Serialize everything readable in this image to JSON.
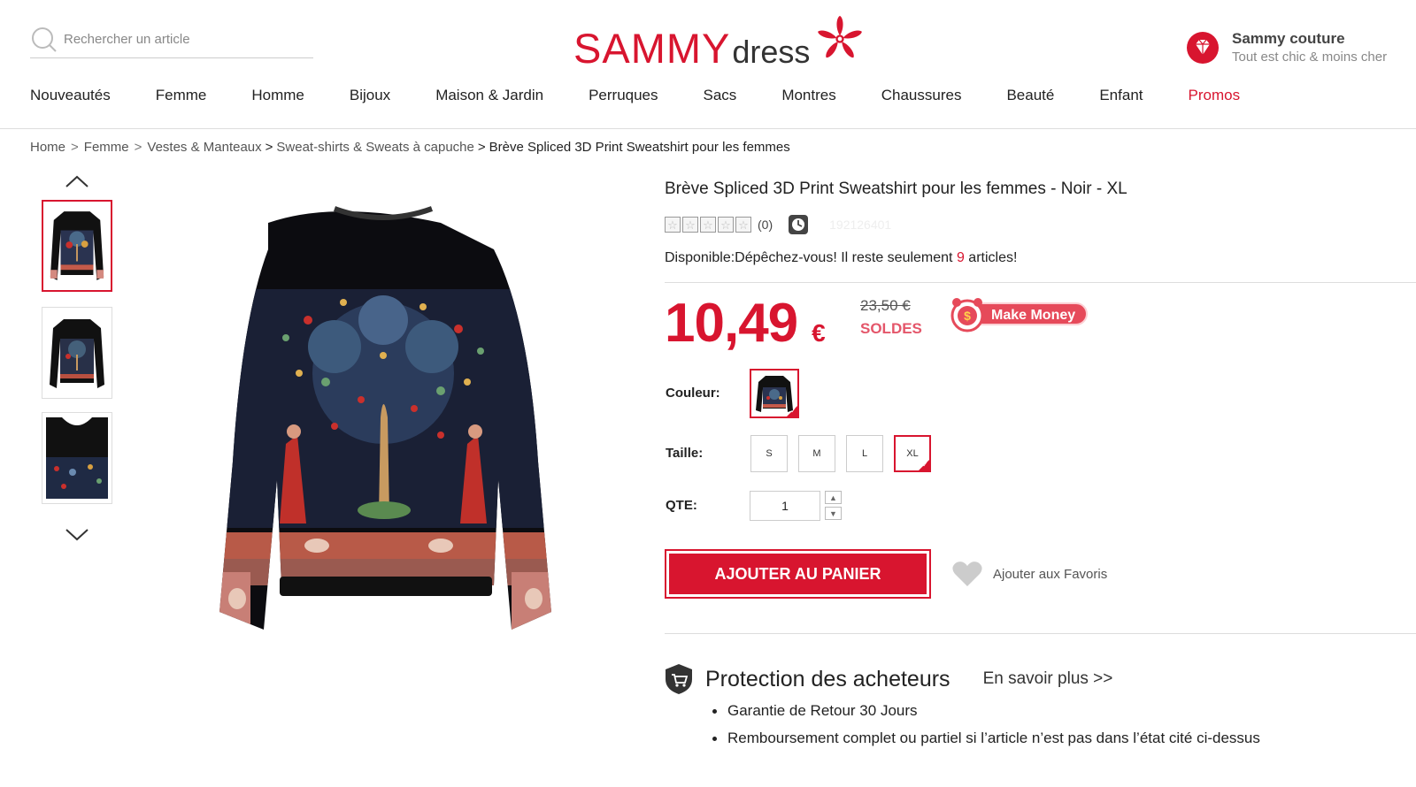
{
  "header": {
    "search_placeholder": "Rechercher un article",
    "logo_primary": "SAMMY",
    "logo_secondary": "dress",
    "brand_title": "Sammy couture",
    "brand_tagline": "Tout est chic & moins cher"
  },
  "nav": {
    "items": [
      "Nouveautés",
      "Femme",
      "Homme",
      "Bijoux",
      "Maison & Jardin",
      "Perruques",
      "Sacs",
      "Montres",
      "Chaussures",
      "Beauté",
      "Enfant"
    ],
    "promo": "Promos"
  },
  "breadcrumb": {
    "items": [
      "Home",
      "Femme",
      "Vestes & Manteaux",
      "Sweat-shirts & Sweats à capuche"
    ],
    "current": "Brève Spliced 3D Print Sweatshirt pour les femmes"
  },
  "product": {
    "title": "Brève Spliced 3D Print Sweatshirt pour les femmes - Noir - XL",
    "rating_count": "(0)",
    "sku": "192126401",
    "stock_prefix": "Disponible:Dépêchez-vous! Il reste seulement ",
    "stock_count": "9",
    "stock_suffix": " articles!",
    "price": "10,49",
    "currency": "€",
    "old_price": "23,50 €",
    "sale_label": "SOLDES",
    "make_money": "Make Money",
    "color_label": "Couleur:",
    "size_label": "Taille:",
    "sizes": [
      "S",
      "M",
      "L",
      "XL"
    ],
    "selected_size": "XL",
    "qty_label": "QTE:",
    "qty_value": "1",
    "add_to_cart": "AJOUTER AU PANIER",
    "add_favorite": "Ajouter aux Favoris"
  },
  "protection": {
    "title": "Protection des acheteurs",
    "more": "En savoir plus >>",
    "items": [
      "Garantie de Retour 30 Jours",
      "Remboursement complet ou partiel si l’article n’est pas dans l’état cité ci-dessus"
    ]
  },
  "colors": {
    "accent": "#d8152f",
    "make_money": "#e64a5a"
  }
}
